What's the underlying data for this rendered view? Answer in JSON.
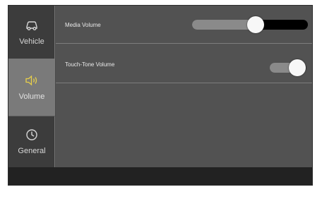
{
  "sidebar": {
    "items": [
      {
        "label": "Vehicle",
        "icon": "car-icon"
      },
      {
        "label": "Volume",
        "icon": "speaker-icon",
        "selected": true
      },
      {
        "label": "General",
        "icon": "clock-icon"
      }
    ]
  },
  "settings": {
    "media_volume": {
      "label": "Media Volume",
      "level": 0.55
    },
    "touch_tone_volume": {
      "label": "Touch-Tone Volume",
      "level": 0.75
    }
  },
  "colors": {
    "accent": "#e8d04a",
    "selected_bg": "#7a7a7a",
    "panel_bg": "#525252"
  }
}
